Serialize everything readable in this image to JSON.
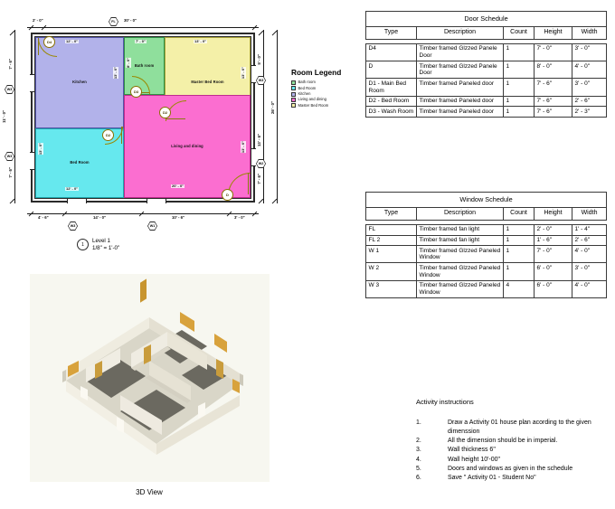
{
  "floor_plan": {
    "title": "Level 1",
    "scale": "1/8\" = 1'-0\"",
    "marker": "1",
    "rooms": [
      {
        "name": "Kitchen",
        "color": "#b2b2ea",
        "width_dim": "12' - 0\"",
        "height_dim": "13' - 0\""
      },
      {
        "name": "Bath room",
        "color": "#8fdf9c",
        "width_dim": "7' - 0\"",
        "height_dim": "8' - 0\""
      },
      {
        "name": "Master Bed Room",
        "color": "#f4f0a8",
        "width_dim": "13' - 0\"",
        "height_dim": "13' - 0\""
      },
      {
        "name": "Bed Room",
        "color": "#66e8ee",
        "width_dim": "12' - 0\"",
        "height_dim": "13' - 0\""
      },
      {
        "name": "Living and dining",
        "color": "#fb6ed0",
        "width_dim": "20' - 0\"",
        "height_dim": "13' - 0\""
      }
    ],
    "dimensions": {
      "top_overall": "30' - 0\"",
      "top_left_offset": "2' - 0\"",
      "right_overall": "26' - 0\"",
      "right_segments": [
        "5' - 0\"",
        "13' - 6\"",
        "7' - 6\""
      ],
      "left_overall": "11' - 0\"",
      "left_segments": [
        "7' - 6\"",
        "7' - 6\""
      ],
      "bottom_segments": [
        "4' - 6\"",
        "14' - 0\"",
        "10' - 6\"",
        "3' - 0\""
      ]
    },
    "door_tags": [
      "D4",
      "D3",
      "D2",
      "D2",
      "D"
    ],
    "window_tags": [
      "FL",
      "W3",
      "W3",
      "W3",
      "W3",
      "W2",
      "W1"
    ]
  },
  "legend": {
    "title": "Room Legend",
    "items": [
      {
        "label": "Bath room",
        "color": "#8fdf9c"
      },
      {
        "label": "Bed Room",
        "color": "#66e8ee"
      },
      {
        "label": "Kitchen",
        "color": "#b2b2ea"
      },
      {
        "label": "Living and dining",
        "color": "#fb6ed0"
      },
      {
        "label": "Master Bed Room",
        "color": "#f4f0a8"
      }
    ]
  },
  "view_3d": {
    "caption": "3D View"
  },
  "door_schedule": {
    "caption": "Door Schedule",
    "columns": [
      "Type",
      "Description",
      "Count",
      "Height",
      "Width"
    ],
    "rows": [
      {
        "type": "D4",
        "description": "Timber framed Glzzed Panele Door",
        "count": "1",
        "height": "7' - 0\"",
        "width": "3' - 0\""
      },
      {
        "type": "D",
        "description": "Timber framed Glzzed Panele Door",
        "count": "1",
        "height": "8' - 0\"",
        "width": "4' - 0\""
      },
      {
        "type": "D1 - Main Bed Room",
        "description": "Timber framed Paneled door",
        "count": "1",
        "height": "7' - 6\"",
        "width": "3' - 0\""
      },
      {
        "type": "D2 -  Bed Room",
        "description": "Timber framed Paneled door",
        "count": "1",
        "height": "7' - 6\"",
        "width": "2' - 6\""
      },
      {
        "type": "D3 -  Wash Room",
        "description": "Timber framed Paneled door",
        "count": "1",
        "height": "7' - 6\"",
        "width": "2' - 3\""
      }
    ]
  },
  "window_schedule": {
    "caption": "Window Schedule",
    "columns": [
      "Type",
      "Description",
      "Count",
      "Height",
      "Width"
    ],
    "rows": [
      {
        "type": "FL",
        "description": "Timber framed fan light",
        "count": "1",
        "height": "2' - 0\"",
        "width": "1' - 4\""
      },
      {
        "type": "FL 2",
        "description": "Timber framed fan light",
        "count": "1",
        "height": "1' - 6\"",
        "width": "2' - 6\""
      },
      {
        "type": "W 1",
        "description": "Timber framed Glzzed Paneled Window",
        "count": "1",
        "height": "7' - 0\"",
        "width": "4' - 0\""
      },
      {
        "type": "W 2",
        "description": "Timber framed Glzzed Paneled Window",
        "count": "1",
        "height": "6' - 0\"",
        "width": "3' - 0\""
      },
      {
        "type": "W 3",
        "description": "Timber framed Glzzed Paneled Window",
        "count": "4",
        "height": "6' - 0\"",
        "width": "4' - 0\""
      }
    ]
  },
  "instructions": {
    "title": "Activity instructions",
    "items": [
      {
        "num": "1.",
        "text": "Draw a Activity 01 house plan acording to the given dimenssion"
      },
      {
        "num": "2.",
        "text": "All the dimension should be in imperial."
      },
      {
        "num": "3.",
        "text": "Wall thickness 6\""
      },
      {
        "num": "4.",
        "text": "Wall height 10'-00\""
      },
      {
        "num": "5.",
        "text": "Doors and windows as given in the schedule"
      },
      {
        "num": "6.",
        "text": "Save \" Activity 01 - Student No\""
      }
    ]
  }
}
